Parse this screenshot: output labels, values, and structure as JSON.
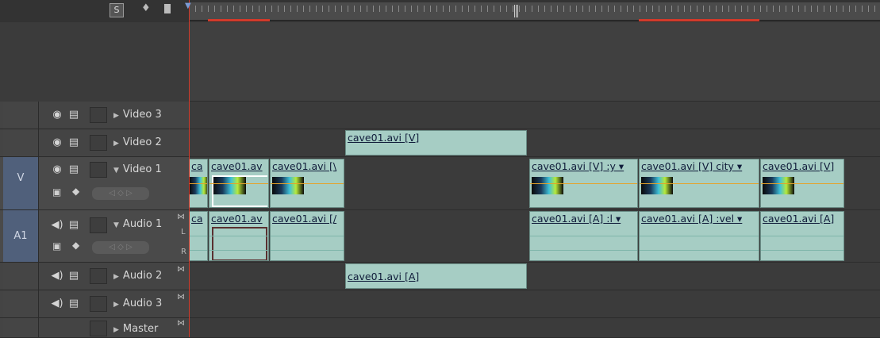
{
  "tracks": {
    "video3": {
      "label": "Video 3"
    },
    "video2": {
      "label": "Video 2"
    },
    "video1": {
      "label": "Video 1",
      "target": "V"
    },
    "audio1": {
      "label": "Audio 1",
      "target": "A1",
      "channel_l": "L",
      "channel_r": "R"
    },
    "audio2": {
      "label": "Audio 2"
    },
    "audio3": {
      "label": "Audio 3"
    },
    "master": {
      "label": "Master"
    }
  },
  "clips": {
    "v2": [
      {
        "name": "cave01.avi",
        "suffix": " [V]"
      }
    ],
    "v1": [
      {
        "name": "ca",
        "suffix": ""
      },
      {
        "name": "cave01.av",
        "suffix": ""
      },
      {
        "name": "cave01.avi",
        "suffix": " [\\"
      },
      {
        "name": "cave01.avi",
        "suffix": " [V]",
        "tail": " :y ▾"
      },
      {
        "name": "cave01.avi",
        "suffix": " [V]",
        "tail": " city ▾"
      },
      {
        "name": "cave01.avi",
        "suffix": " [V]"
      }
    ],
    "a1": [
      {
        "name": "ca",
        "suffix": ""
      },
      {
        "name": "cave01.av",
        "suffix": ""
      },
      {
        "name": "cave01.avi",
        "suffix": " [/"
      },
      {
        "name": "cave01.avi",
        "suffix": " [A]",
        "tail": " :l ▾"
      },
      {
        "name": "cave01.avi",
        "suffix": " [A]",
        "tail": " :vel ▾"
      },
      {
        "name": "cave01.avi",
        "suffix": " [A]"
      }
    ],
    "a2": [
      {
        "name": "cave01.avi",
        "suffix": " [A]"
      }
    ]
  },
  "icons": {
    "eye": "◉",
    "filmstrip": "▤",
    "speaker": "◀)",
    "triangle_right": "▶",
    "triangle_down": "▼",
    "kf_nav": "◁ ◇ ▷",
    "bowtie": "⋈"
  },
  "colors": {
    "clip": "#a6cdc4",
    "playhead": "#d23a2a",
    "workarea": "#d23a2a",
    "target": "#50607b"
  }
}
